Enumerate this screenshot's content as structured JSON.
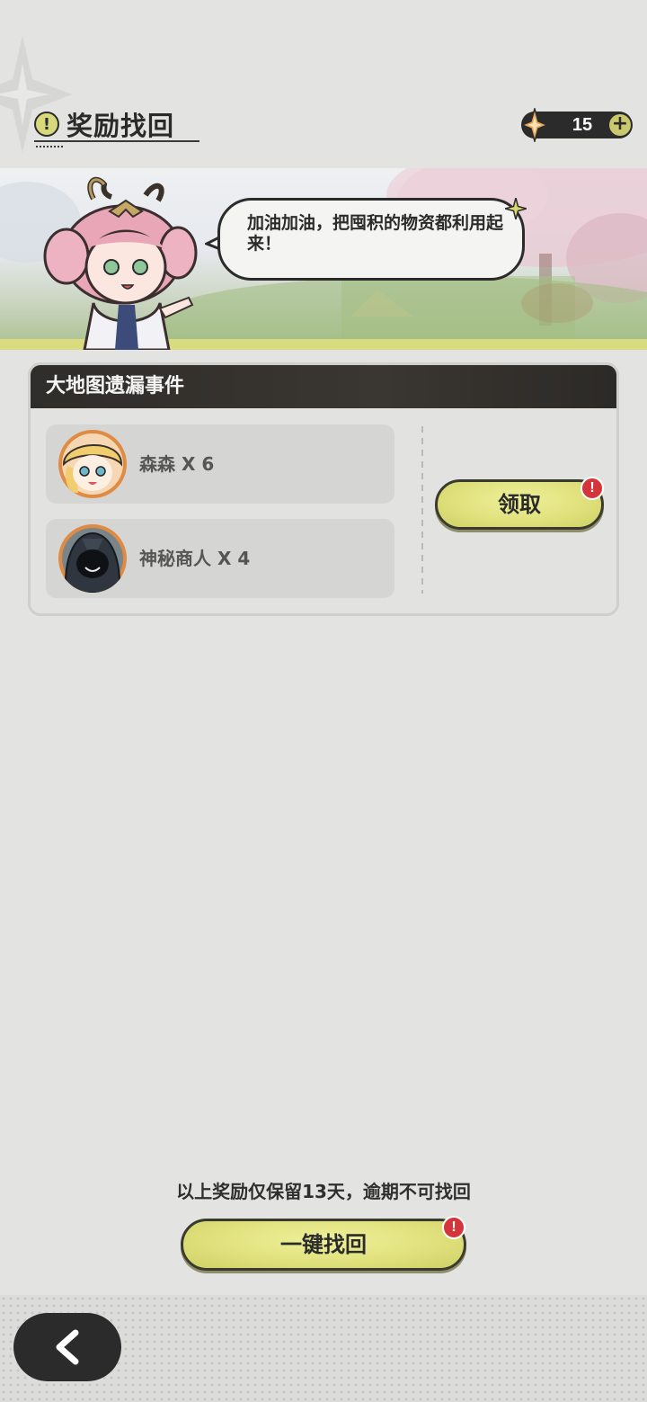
{
  "header": {
    "title": "奖励找回",
    "alert_icon": "!",
    "currency": {
      "icon": "star-gem-icon",
      "amount": "15",
      "plus_label": "+"
    }
  },
  "banner": {
    "speech": "加油加油，把囤积的物资都利用起来！",
    "mascot": "mascot-character"
  },
  "event_card": {
    "title": "大地图遗漏事件",
    "items": [
      {
        "label": "森森 X 6",
        "avatar": "blonde-character-avatar"
      },
      {
        "label": "神秘商人 X 4",
        "avatar": "hooded-merchant-avatar"
      }
    ],
    "claim_label": "领取",
    "badge": "!"
  },
  "footer": {
    "notice": "以上奖励仅保留13天，逾期不可找回",
    "one_key_label": "一键找回",
    "badge": "!",
    "back_icon": "chevron-left-icon"
  },
  "colors": {
    "background": "#e3e3e1",
    "accent_yellow": "#dfe07b",
    "dark": "#2b2b2b",
    "badge_red": "#d3353a"
  }
}
